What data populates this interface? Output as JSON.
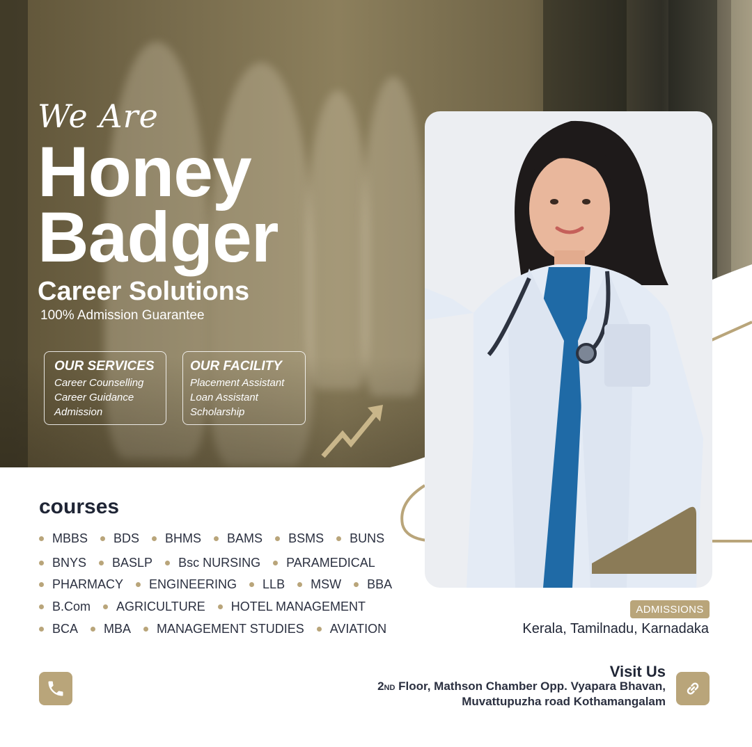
{
  "hero": {
    "script_title": "We Are",
    "brand_line1": "Honey",
    "brand_line2": "Badger",
    "subtitle": "Career Solutions",
    "tagline": "100% Admission Guarantee"
  },
  "services": {
    "title": "OUR SERVICES",
    "items": [
      "Career Counselling",
      "Career Guidance",
      "Admission"
    ]
  },
  "facility": {
    "title": "OUR FACILITY",
    "items": [
      "Placement Assistant",
      "Loan Assistant",
      "Scholarship"
    ]
  },
  "courses": {
    "title": "courses",
    "rows": [
      [
        "MBBS",
        "BDS",
        "BHMS",
        "BAMS",
        "BSMS",
        "BUNS"
      ],
      [
        "BNYS",
        "BASLP",
        "Bsc NURSING",
        "PARAMEDICAL"
      ],
      [
        "PHARMACY",
        "ENGINEERING",
        "LLB",
        "MSW",
        "BBA"
      ],
      [
        "B.Com",
        "AGRICULTURE",
        "HOTEL MANAGEMENT"
      ],
      [
        "BCA",
        "MBA",
        "MANAGEMENT STUDIES",
        "AVIATION"
      ]
    ]
  },
  "admissions": {
    "badge": "ADMISSIONS",
    "states": "Kerala, Tamilnadu, Karnadaka"
  },
  "visit": {
    "title": "Visit Us",
    "floor_number": "2",
    "floor_suffix": "ND",
    "address_line1_rest": " Floor, Mathson Chamber Opp. Vyapara Bhavan,",
    "address_line2": "Muvattupuzha road Kothamangalam"
  },
  "icons": {
    "phone": "phone-icon",
    "link": "link-icon",
    "growth_arrow": "trend-arrow-icon"
  },
  "colors": {
    "gold": "#b9a57a",
    "navy_text": "#1f2535",
    "white": "#ffffff"
  }
}
